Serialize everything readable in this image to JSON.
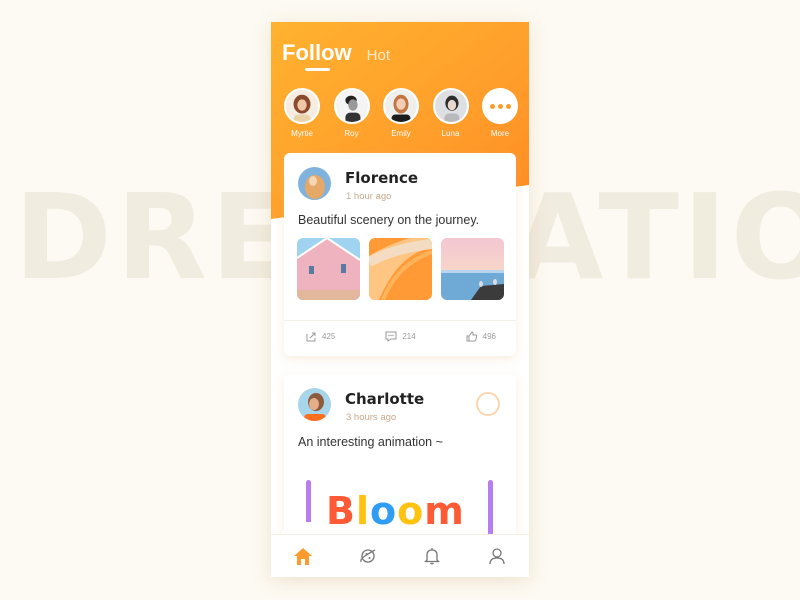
{
  "background": {
    "word": "DREAMATION"
  },
  "header": {
    "tabs": [
      {
        "label": "Follow",
        "active": true
      },
      {
        "label": "Hot",
        "active": false
      }
    ],
    "accent_color": "#ff9d2b"
  },
  "stories": [
    {
      "name": "Myrtie",
      "avatar": "avatar-photo"
    },
    {
      "name": "Roy",
      "avatar": "avatar-photo"
    },
    {
      "name": "Emily",
      "avatar": "avatar-photo"
    },
    {
      "name": "Luna",
      "avatar": "avatar-photo"
    },
    {
      "name": "More",
      "avatar": "more-dots-icon"
    }
  ],
  "posts": [
    {
      "author": "Florence",
      "time": "1 hour ago",
      "text": "Beautiful scenery on the journey.",
      "images": [
        "pink-building",
        "orange-staircase",
        "sea-with-birds"
      ],
      "shares": "425",
      "comments": "214",
      "likes": "496"
    },
    {
      "author": "Charlotte",
      "time": "3 hours ago",
      "text": "An interesting animation ~",
      "animation_word": "Bloom",
      "animation_letters": [
        {
          "char": "B",
          "color": "#ff5a36"
        },
        {
          "char": "l",
          "color": "#ffc20e"
        },
        {
          "char": "o",
          "color": "#2f9df4"
        },
        {
          "char": "o",
          "color": "#ffc20e"
        },
        {
          "char": "m",
          "color": "#ff5a36"
        }
      ]
    }
  ],
  "nav": [
    {
      "name": "home",
      "active": true
    },
    {
      "name": "discover",
      "active": false
    },
    {
      "name": "notifications",
      "active": false
    },
    {
      "name": "profile",
      "active": false
    }
  ]
}
